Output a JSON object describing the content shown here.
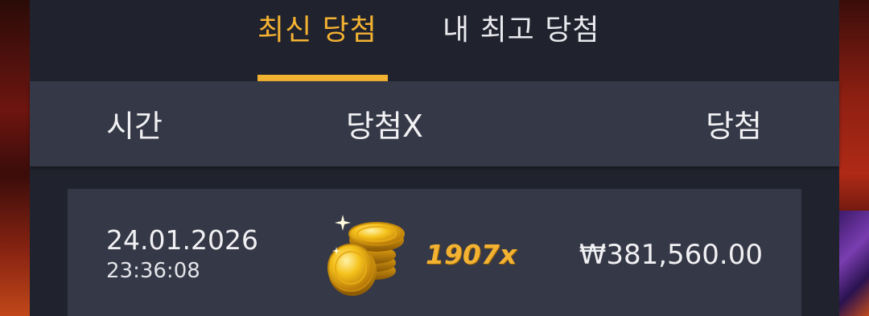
{
  "tabs": [
    {
      "label": "최신 당첨",
      "active": true
    },
    {
      "label": "내 최고 당첨",
      "active": false
    }
  ],
  "table": {
    "columns": [
      "시간",
      "당첨X",
      "당첨"
    ],
    "rows": [
      {
        "date": "24.01.2026",
        "time": "23:36:08",
        "multiplier": "1907x",
        "win": "₩381,560.00",
        "icon": "coin-stack-icon"
      }
    ]
  },
  "colors": {
    "accent": "#f3b232",
    "panel": "#20222d",
    "row": "#353846",
    "text": "#f1f1f4"
  }
}
